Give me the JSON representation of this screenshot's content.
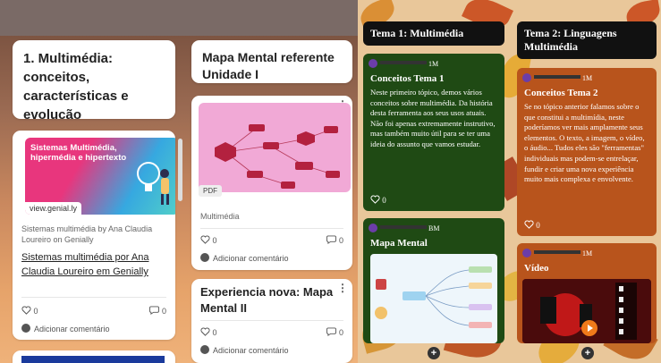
{
  "colors": {
    "green_card": "#1f4a14",
    "orange_card": "#b8541c",
    "title_bg": "#111111",
    "genially_pink": "#e8367d",
    "map_pink": "#f1a9d6"
  },
  "left_board": {
    "column1": {
      "title": "1. Multimédia: conceitos, características e evolução",
      "post": {
        "thumbnail_title": "Sistemas Multimédia, hipermédia e hipertexto",
        "thumbnail_url": "view.genial.ly",
        "meta": "Sistemas multimédia by Ana Claudia Loureiro on Genially",
        "link": "Sistemas multimédia por Ana Claudia Loureiro em Genially",
        "likes": "0",
        "comments": "0",
        "add_comment": "Adicionar comentário"
      }
    },
    "column2": {
      "title": "Mapa Mental referente Unidade I",
      "post1": {
        "file_type": "PDF",
        "caption": "Multimédia",
        "likes": "0",
        "comments": "0",
        "add_comment": "Adicionar comentário"
      },
      "post2": {
        "title": "Experiencia nova: Mapa Mental II",
        "likes": "0",
        "comments": "0",
        "add_comment": "Adicionar comentário"
      }
    }
  },
  "right_board": {
    "col1": {
      "title": "Tema 1: Multimédia",
      "card1": {
        "time": "1M",
        "heading": "Conceitos Tema 1",
        "body": "Neste primeiro tópico, demos vários conceitos sobre multimédia. Da história desta ferramenta aos seus usos atuais. Não foi apenas extremamente instrutivo, mas também muito útil para se ter uma ideia do assunto que vamos estudar.",
        "likes": "0"
      },
      "card2": {
        "time": "BM",
        "heading": "Mapa Mental"
      },
      "add": "+"
    },
    "col2": {
      "title": "Tema 2: Linguagens Multimédia",
      "card1": {
        "time": "1M",
        "heading": "Conceitos Tema 2",
        "body": "Se no tópico anterior falamos sobre o que constitui a multimídia, neste poderíamos ver mais amplamente seus elementos. O texto, a imagem, o vídeo, o áudio... Tudos eles são \"ferramentas\" individuais mas podem-se entrelaçar, fundir e criar uma nova experiência muito mais complexa e envolvente.",
        "likes": "0"
      },
      "card2": {
        "time": "1M",
        "heading": "Vídeo"
      },
      "add": "+"
    }
  }
}
